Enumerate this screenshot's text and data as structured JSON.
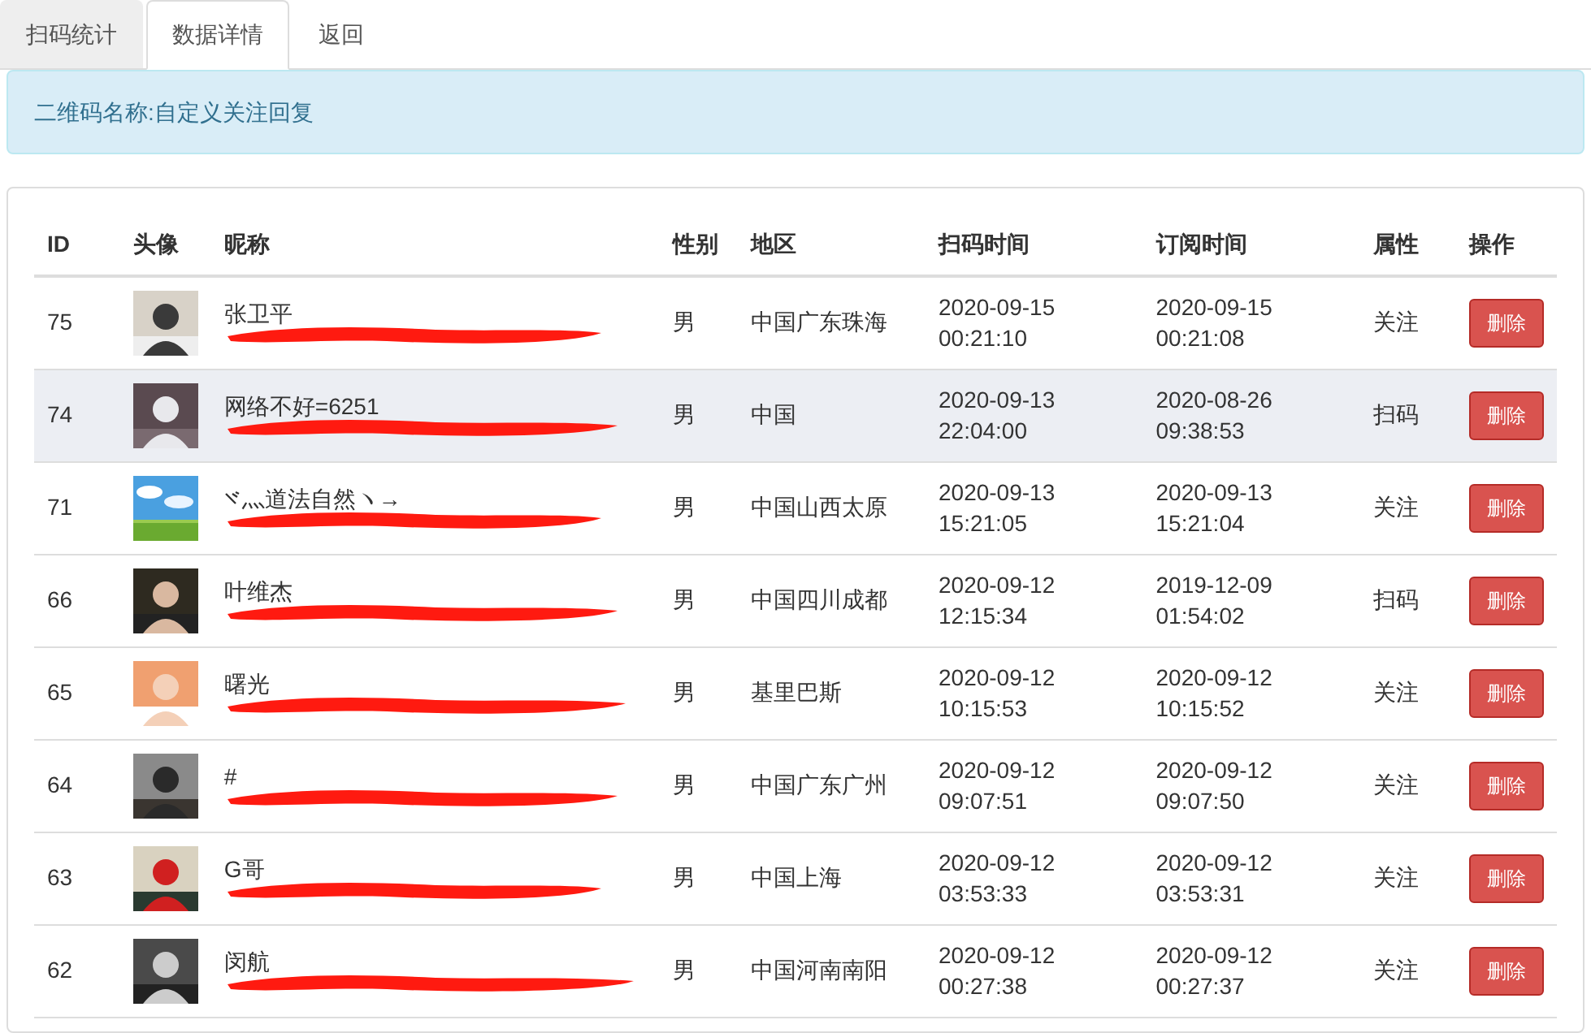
{
  "tabs": [
    {
      "label": "扫码统计",
      "selected": false
    },
    {
      "label": "数据详情",
      "selected": true
    },
    {
      "label": "返回",
      "selected": false
    }
  ],
  "alert": {
    "text": "二维码名称:自定义关注回复"
  },
  "table": {
    "columns": [
      "ID",
      "头像",
      "昵称",
      "性别",
      "地区",
      "扫码时间",
      "订阅时间",
      "属性",
      "操作"
    ],
    "rows": [
      {
        "id": "75",
        "nickname": "张卫平",
        "gender": "男",
        "region": "中国广东珠海",
        "scan_date": "2020-09-15",
        "scan_time": "00:21:10",
        "sub_date": "2020-09-15",
        "sub_time": "00:21:08",
        "attribute": "关注",
        "action": "删除",
        "highlighted": false
      },
      {
        "id": "74",
        "nickname": "网络不好=6251",
        "gender": "男",
        "region": "中国",
        "scan_date": "2020-09-13",
        "scan_time": "22:04:00",
        "sub_date": "2020-08-26",
        "sub_time": "09:38:53",
        "attribute": "扫码",
        "action": "删除",
        "highlighted": true
      },
      {
        "id": "71",
        "nickname": "灬道法自然ヽ→",
        "nickname_icon": true,
        "gender": "男",
        "region": "中国山西太原",
        "scan_date": "2020-09-13",
        "scan_time": "15:21:05",
        "sub_date": "2020-09-13",
        "sub_time": "15:21:04",
        "attribute": "关注",
        "action": "删除",
        "highlighted": false
      },
      {
        "id": "66",
        "nickname": "叶维杰",
        "gender": "男",
        "region": "中国四川成都",
        "scan_date": "2020-09-12",
        "scan_time": "12:15:34",
        "sub_date": "2019-12-09",
        "sub_time": "01:54:02",
        "attribute": "扫码",
        "action": "删除",
        "highlighted": false
      },
      {
        "id": "65",
        "nickname": "曙光",
        "gender": "男",
        "region": "基里巴斯",
        "scan_date": "2020-09-12",
        "scan_time": "10:15:53",
        "sub_date": "2020-09-12",
        "sub_time": "10:15:52",
        "attribute": "关注",
        "action": "删除",
        "highlighted": false
      },
      {
        "id": "64",
        "nickname": "#",
        "gender": "男",
        "region": "中国广东广州",
        "scan_date": "2020-09-12",
        "scan_time": "09:07:51",
        "sub_date": "2020-09-12",
        "sub_time": "09:07:50",
        "attribute": "关注",
        "action": "删除",
        "highlighted": false
      },
      {
        "id": "63",
        "nickname": "G哥",
        "gender": "男",
        "region": "中国上海",
        "scan_date": "2020-09-12",
        "scan_time": "03:53:33",
        "sub_date": "2020-09-12",
        "sub_time": "03:53:31",
        "attribute": "关注",
        "action": "删除",
        "highlighted": false
      },
      {
        "id": "62",
        "nickname": "闵航",
        "gender": "男",
        "region": "中国河南南阳",
        "scan_date": "2020-09-12",
        "scan_time": "00:27:38",
        "sub_date": "2020-09-12",
        "sub_time": "00:27:37",
        "attribute": "关注",
        "action": "删除",
        "highlighted": false
      }
    ]
  }
}
